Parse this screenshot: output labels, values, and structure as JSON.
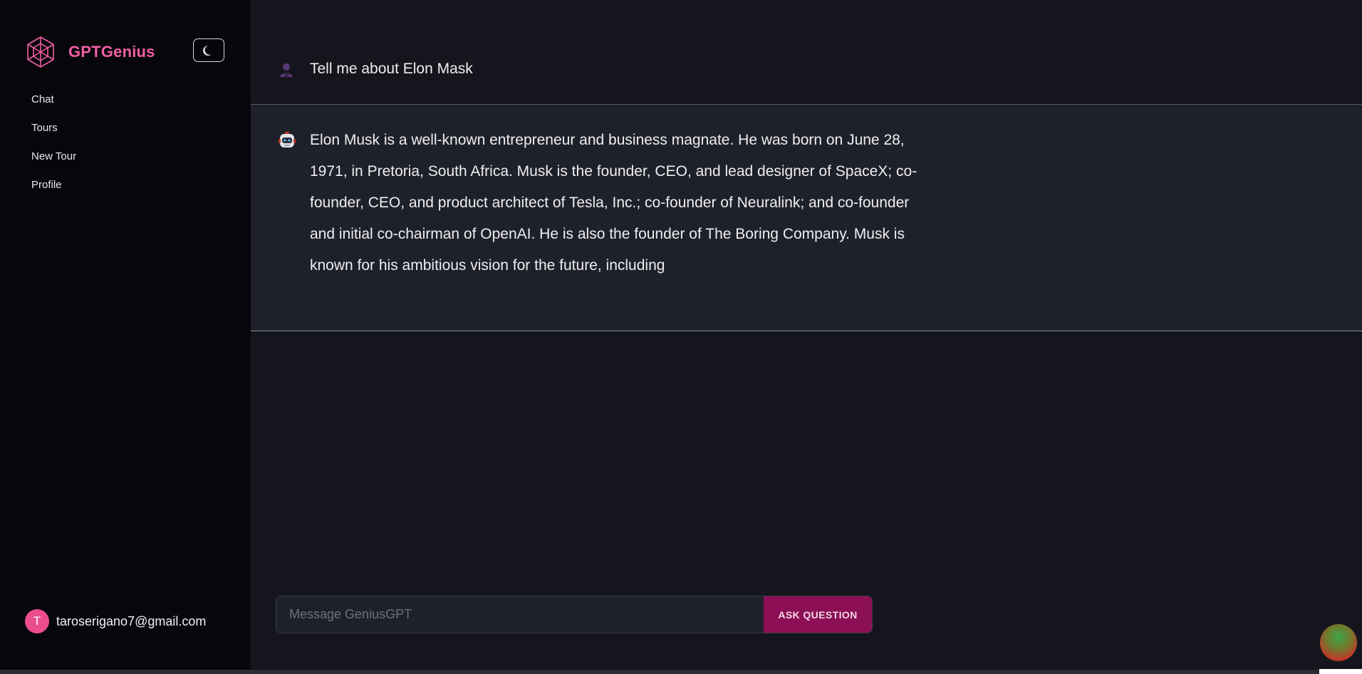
{
  "sidebar": {
    "brand_name": "GPTGenius",
    "theme_toggle_icon": "moon-icon",
    "nav": [
      {
        "label": "Chat"
      },
      {
        "label": "Tours"
      },
      {
        "label": "New Tour"
      },
      {
        "label": "Profile"
      }
    ],
    "user": {
      "avatar_letter": "T",
      "email": "taroserigano7@gmail.com"
    }
  },
  "chat": {
    "messages": [
      {
        "role": "user",
        "icon": "user-icon",
        "text": "Tell me about Elon Mask"
      },
      {
        "role": "assistant",
        "icon": "robot-icon",
        "text": "Elon Musk is a well-known entrepreneur and business magnate. He was born on June 28, 1971, in Pretoria, South Africa. Musk is the founder, CEO, and lead designer of SpaceX; co-founder, CEO, and product architect of Tesla, Inc.; co-founder of Neuralink; and co-founder and initial co-chairman of OpenAI. He is also the founder of The Boring Company. Musk is known for his ambitious vision for the future, including"
      }
    ]
  },
  "composer": {
    "placeholder": "Message GeniusGPT",
    "value": "",
    "button_label": "ASK QUESTION"
  },
  "colors": {
    "sidebar_bg": "#07060b",
    "main_bg": "#15161d",
    "assistant_bg": "#1f212a",
    "brand_pink": "#f15fa5",
    "button_bg": "#8c0f55",
    "avatar_bg": "#ec4d8f"
  }
}
